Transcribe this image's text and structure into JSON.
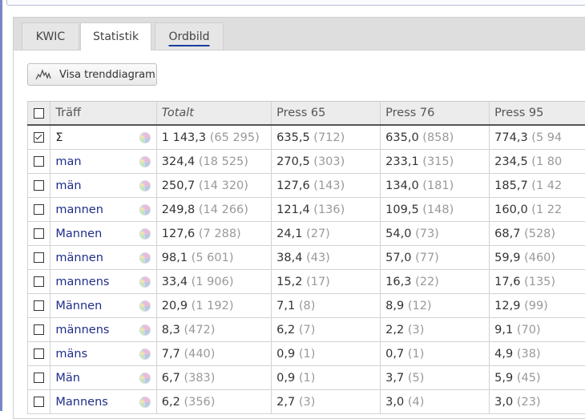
{
  "tabs": [
    {
      "label": "KWIC"
    },
    {
      "label": "Statistik"
    },
    {
      "label": "Ordbild"
    }
  ],
  "trend_button": {
    "label": "Visa trenddiagram",
    "icon": "trend-chart-icon"
  },
  "table": {
    "columns": [
      "Träff",
      "Totalt",
      "Press 65",
      "Press 76",
      "Press 95"
    ],
    "rows": [
      {
        "word": "Σ",
        "checked": true,
        "cells": [
          [
            "1 143,3",
            "(65 295)"
          ],
          [
            "635,5",
            "(712)"
          ],
          [
            "635,0",
            "(858)"
          ],
          [
            "774,3",
            "(5 94"
          ]
        ]
      },
      {
        "word": "man",
        "checked": false,
        "cells": [
          [
            "324,4",
            "(18 525)"
          ],
          [
            "270,5",
            "(303)"
          ],
          [
            "233,1",
            "(315)"
          ],
          [
            "234,5",
            "(1 80"
          ]
        ]
      },
      {
        "word": "män",
        "checked": false,
        "cells": [
          [
            "250,7",
            "(14 320)"
          ],
          [
            "127,6",
            "(143)"
          ],
          [
            "134,0",
            "(181)"
          ],
          [
            "185,7",
            "(1 42"
          ]
        ]
      },
      {
        "word": "mannen",
        "checked": false,
        "cells": [
          [
            "249,8",
            "(14 266)"
          ],
          [
            "121,4",
            "(136)"
          ],
          [
            "109,5",
            "(148)"
          ],
          [
            "160,0",
            "(1 22"
          ]
        ]
      },
      {
        "word": "Mannen",
        "checked": false,
        "cells": [
          [
            "127,6",
            "(7 288)"
          ],
          [
            "24,1",
            "(27)"
          ],
          [
            "54,0",
            "(73)"
          ],
          [
            "68,7",
            "(528)"
          ]
        ]
      },
      {
        "word": "männen",
        "checked": false,
        "cells": [
          [
            "98,1",
            "(5 601)"
          ],
          [
            "38,4",
            "(43)"
          ],
          [
            "57,0",
            "(77)"
          ],
          [
            "59,9",
            "(460)"
          ]
        ]
      },
      {
        "word": "mannens",
        "checked": false,
        "cells": [
          [
            "33,4",
            "(1 906)"
          ],
          [
            "15,2",
            "(17)"
          ],
          [
            "16,3",
            "(22)"
          ],
          [
            "17,6",
            "(135)"
          ]
        ]
      },
      {
        "word": "Männen",
        "checked": false,
        "cells": [
          [
            "20,9",
            "(1 192)"
          ],
          [
            "7,1",
            "(8)"
          ],
          [
            "8,9",
            "(12)"
          ],
          [
            "12,9",
            "(99)"
          ]
        ]
      },
      {
        "word": "männens",
        "checked": false,
        "cells": [
          [
            "8,3",
            "(472)"
          ],
          [
            "6,2",
            "(7)"
          ],
          [
            "2,2",
            "(3)"
          ],
          [
            "9,1",
            "(70)"
          ]
        ]
      },
      {
        "word": "mäns",
        "checked": false,
        "cells": [
          [
            "7,7",
            "(440)"
          ],
          [
            "0,9",
            "(1)"
          ],
          [
            "0,7",
            "(1)"
          ],
          [
            "4,9",
            "(38)"
          ]
        ]
      },
      {
        "word": "Män",
        "checked": false,
        "cells": [
          [
            "6,7",
            "(383)"
          ],
          [
            "0,9",
            "(1)"
          ],
          [
            "3,7",
            "(5)"
          ],
          [
            "5,9",
            "(45)"
          ]
        ]
      },
      {
        "word": "Mannens",
        "checked": false,
        "cells": [
          [
            "6,2",
            "(356)"
          ],
          [
            "2,7",
            "(3)"
          ],
          [
            "3,0",
            "(4)"
          ],
          [
            "3,0",
            "(23)"
          ]
        ]
      }
    ]
  }
}
